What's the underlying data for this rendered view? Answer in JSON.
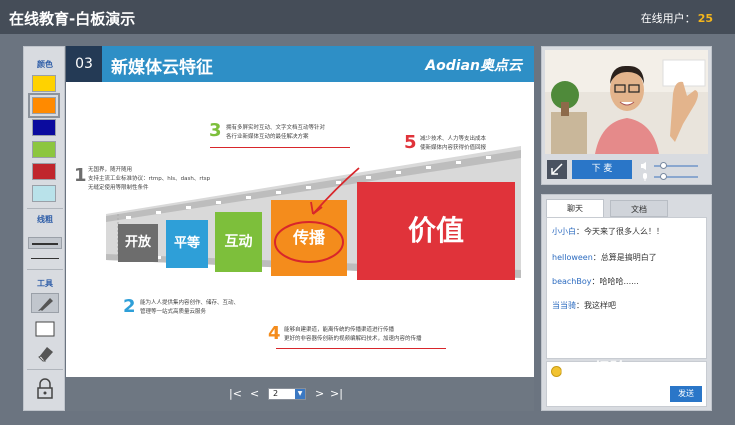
{
  "app": {
    "title": "在线教育-白板演示",
    "online_label": "在线用户：",
    "online_count": "25"
  },
  "toolbar": {
    "color_label": "颜色",
    "colors": [
      "#ffd200",
      "#ff8a00",
      "#0b0b9e",
      "#8cc63f",
      "#c0262d",
      "#b9e2ea"
    ],
    "selected_color": "#ff8a00",
    "line_label": "线粗",
    "tool_label": "工具"
  },
  "slide": {
    "number": "03",
    "title": "新媒体云特征",
    "brand": "Aodian奥点云",
    "notes": [
      {
        "num": "1",
        "lines": [
          "无国界，随开随用",
          "支持主流工业标准协议：rtmp、hls、dash、rtsp",
          "无缝定使用等限制性条件"
        ]
      },
      {
        "num": "2",
        "lines": [
          "能为人人提供集内容创作、储存、互动、",
          "管理等一站式高质量云服务"
        ]
      },
      {
        "num": "3",
        "lines": [
          "拥有多屏实时互动、文字文档互动等针对",
          "各行业新媒体互动的最佳解决方案"
        ]
      },
      {
        "num": "4",
        "lines": [
          "能够自建渠道，能离传统的传播渠道进行传播",
          "更好的非容器传创新的视频编解码技术，加速内容的传播"
        ]
      },
      {
        "num": "5",
        "lines": [
          "减少技术、人力等支出成本",
          "使新媒体内容获得价值回报"
        ]
      }
    ],
    "boxes": [
      {
        "label": "开放",
        "color": "#6d6d6d"
      },
      {
        "label": "平等",
        "color": "#2e9fd8"
      },
      {
        "label": "互动",
        "color": "#7dbf3b"
      },
      {
        "label": "传播",
        "color": "#f48c1c"
      },
      {
        "label": "价值",
        "color": "#e0333a"
      }
    ]
  },
  "pager": {
    "first": "|<",
    "prev": "<",
    "page": "2",
    "next": ">",
    "last": ">|"
  },
  "video": {
    "mic_button": "下 麦"
  },
  "chat": {
    "tabs": [
      "聊天",
      "文档"
    ],
    "messages": [
      {
        "user": "小小白",
        "text": "今天来了很多人么！！"
      },
      {
        "user": "helloween",
        "text": "总算是搞明白了"
      },
      {
        "user": "beachBoy",
        "text": "哈哈哈......"
      },
      {
        "user": "当当骑",
        "text": "我这样吧"
      }
    ],
    "send": "发送"
  },
  "watermark": {
    "line1": "Bai 经验",
    "line2": "jingyan.baidu.com"
  }
}
